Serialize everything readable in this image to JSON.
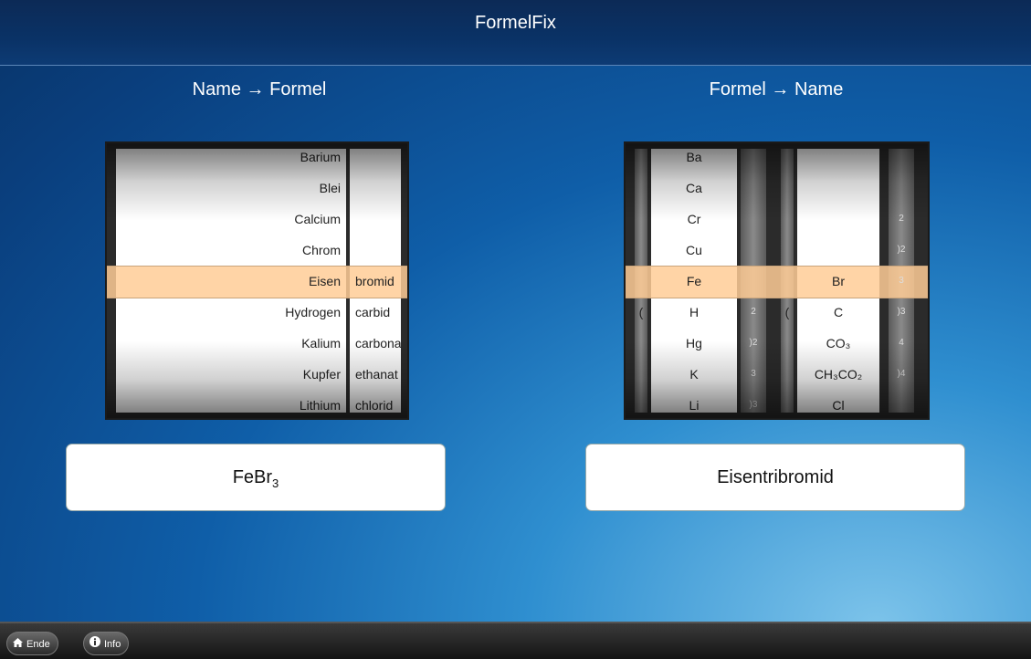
{
  "app": {
    "title": "FormelFix"
  },
  "left": {
    "title": "Name → Formel",
    "col1": [
      "Barium",
      "Blei",
      "Calcium",
      "Chrom",
      "Eisen",
      "Hydrogen",
      "Kalium",
      "Kupfer",
      "Lithium"
    ],
    "col2": [
      "",
      "",
      "",
      "",
      "bromid",
      "carbid",
      "carbonat",
      "ethanat",
      "chlorid"
    ],
    "selected_index": 4,
    "result_symbol": "FeBr",
    "result_subscript": "3"
  },
  "right": {
    "title": "Formel → Name",
    "col_paren1": [
      "",
      "",
      "",
      "",
      "",
      "(",
      "",
      "",
      ""
    ],
    "col_elements": [
      "Ba",
      "Ca",
      "Cr",
      "Cu",
      "Fe",
      "H",
      "Hg",
      "K",
      "Li"
    ],
    "col_index1": [
      "",
      "",
      "",
      "",
      "",
      "2",
      ")2",
      "3",
      ")3"
    ],
    "col_paren2": [
      "",
      "",
      "",
      "",
      "",
      "(",
      "",
      "",
      ""
    ],
    "col_anions": [
      "",
      "",
      "",
      "",
      "Br",
      "C",
      "CO₃",
      "CH₃CO₂",
      "Cl"
    ],
    "col_index2": [
      "",
      "",
      "2",
      ")2",
      "3",
      ")3",
      "4",
      ")4",
      ""
    ],
    "result": "Eisentribromid"
  },
  "footer": {
    "end_label": "Ende",
    "info_label": "Info"
  }
}
